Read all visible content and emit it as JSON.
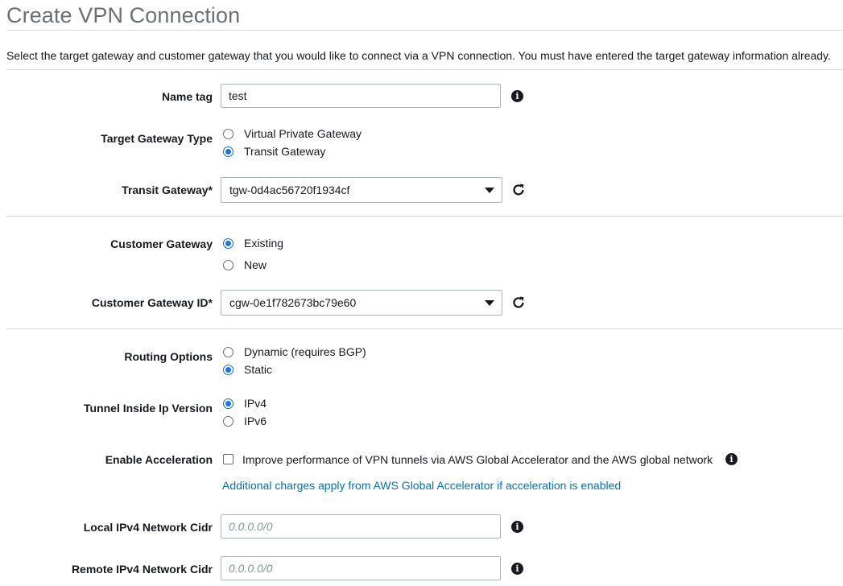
{
  "page": {
    "title": "Create VPN Connection",
    "description": "Select the target gateway and customer gateway that you would like to connect via a VPN connection. You must have entered the target gateway information already."
  },
  "form": {
    "name_tag": {
      "label": "Name tag",
      "value": "test",
      "info_icon": "info-icon"
    },
    "target_gateway_type": {
      "label": "Target Gateway Type",
      "options": [
        {
          "label": "Virtual Private Gateway",
          "selected": false
        },
        {
          "label": "Transit Gateway",
          "selected": true
        }
      ]
    },
    "transit_gateway": {
      "label": "Transit Gateway*",
      "value": "tgw-0d4ac56720f1934cf",
      "refresh_icon": "refresh-icon"
    },
    "customer_gateway": {
      "label": "Customer Gateway",
      "options": [
        {
          "label": "Existing",
          "selected": true
        },
        {
          "label": "New",
          "selected": false
        }
      ]
    },
    "customer_gateway_id": {
      "label": "Customer Gateway ID*",
      "value": "cgw-0e1f782673bc79e60",
      "refresh_icon": "refresh-icon"
    },
    "routing_options": {
      "label": "Routing Options",
      "options": [
        {
          "label": "Dynamic (requires BGP)",
          "selected": false
        },
        {
          "label": "Static",
          "selected": true
        }
      ]
    },
    "tunnel_ip_version": {
      "label": "Tunnel Inside Ip Version",
      "options": [
        {
          "label": "IPv4",
          "selected": true
        },
        {
          "label": "IPv6",
          "selected": false
        }
      ]
    },
    "acceleration": {
      "label": "Enable Acceleration",
      "checkbox_label": "Improve performance of VPN tunnels via AWS Global Accelerator and the AWS global network",
      "checked": false,
      "note": "Additional charges apply from AWS Global Accelerator if acceleration is enabled"
    },
    "local_cidr": {
      "label": "Local IPv4 Network Cidr",
      "value": "",
      "placeholder": "0.0.0.0/0"
    },
    "remote_cidr": {
      "label": "Remote IPv4 Network Cidr",
      "value": "",
      "placeholder": "0.0.0.0/0"
    }
  },
  "colors": {
    "radio_selected": "#1a73e8",
    "link": "#0073bb",
    "title": "#6b6f75",
    "divider": "#d5dbdb"
  }
}
